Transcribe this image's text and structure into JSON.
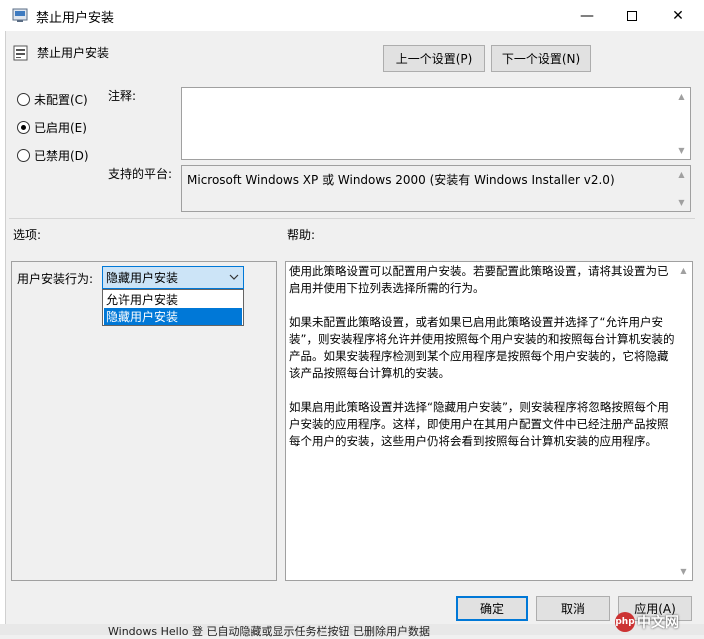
{
  "window": {
    "title": "禁止用户安装",
    "minimize_glyph": "—",
    "close_glyph": "✕"
  },
  "header": {
    "policy_name": "禁止用户安装",
    "prev_label": "上一个设置(P)",
    "next_label": "下一个设置(N)"
  },
  "state": {
    "options": [
      {
        "label": "未配置(C)",
        "checked": false
      },
      {
        "label": "已启用(E)",
        "checked": true
      },
      {
        "label": "已禁用(D)",
        "checked": false
      }
    ]
  },
  "comment": {
    "label": "注释:",
    "value": ""
  },
  "platform": {
    "label": "支持的平台:",
    "value": "Microsoft Windows XP 或 Windows 2000 (安装有 Windows Installer v2.0)"
  },
  "options_section": {
    "title": "选项:",
    "behavior_label": "用户安装行为:",
    "selected": "隐藏用户安装",
    "dropdown_options": [
      "允许用户安装",
      "隐藏用户安装"
    ]
  },
  "help_section": {
    "title": "帮助:",
    "paragraphs": [
      "使用此策略设置可以配置用户安装。若要配置此策略设置，请将其设置为已启用并使用下拉列表选择所需的行为。",
      "如果未配置此策略设置，或者如果已启用此策略设置并选择了“允许用户安装”，则安装程序将允许并使用按照每个用户安装的和按照每台计算机安装的产品。如果安装程序检测到某个应用程序是按照每个用户安装的，它将隐藏该产品按照每台计算机的安装。",
      "如果启用此策略设置并选择“隐藏用户安装”，则安装程序将忽略按照每个用户安装的应用程序。这样，即使用户在其用户配置文件中已经注册产品按照每个用户的安装，这些用户仍将会看到按照每台计算机安装的应用程序。"
    ]
  },
  "footer": {
    "ok_label": "确定",
    "cancel_label": "取消",
    "apply_label": "应用(A)"
  },
  "background": {
    "taskbar_text": "Windows Hello 登        已自动隐藏或显示任务栏按钮       已删除用户数据"
  },
  "watermark": {
    "logo": "php",
    "text": "中文网"
  },
  "colors": {
    "accent": "#0078d7",
    "selection_bg": "#cce4f7",
    "dialog_bg": "#f0f0f0"
  }
}
